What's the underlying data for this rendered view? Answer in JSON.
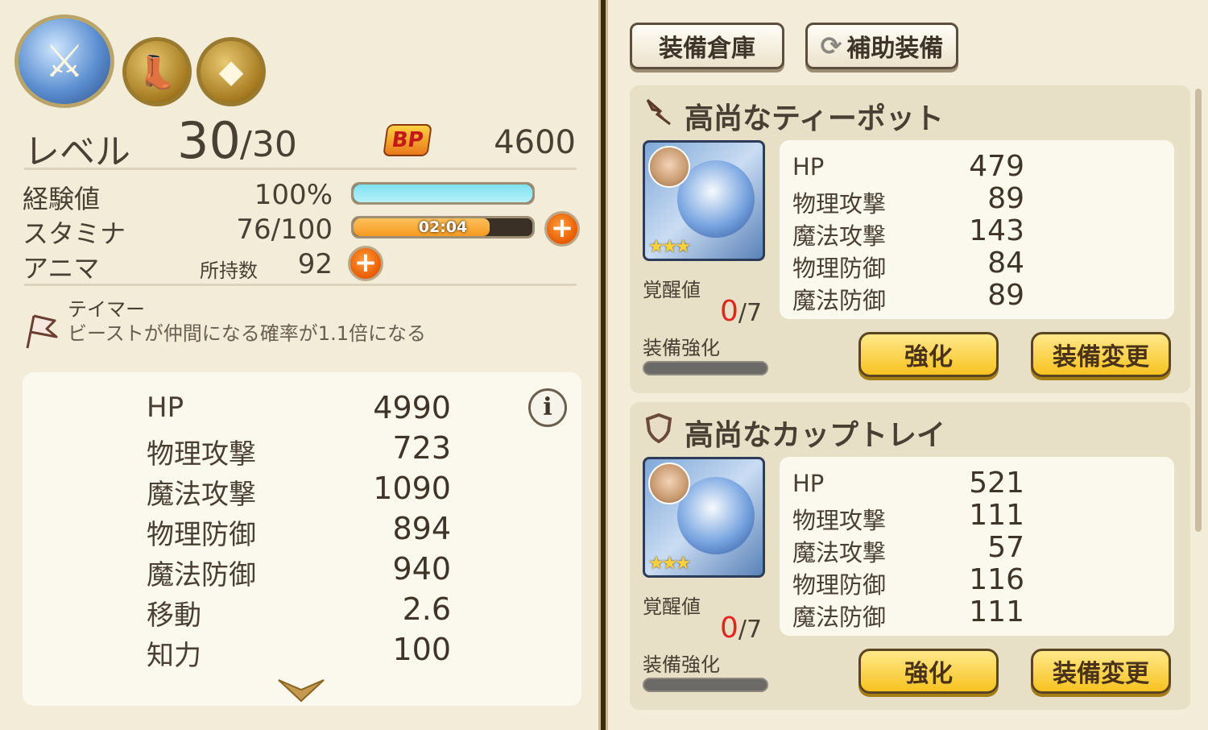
{
  "skills": [
    {
      "icon": "sword-skill-icon"
    },
    {
      "icon": "boot-skill-icon"
    },
    {
      "icon": "block-skill-icon"
    }
  ],
  "level": {
    "label": "レベル",
    "current": "30",
    "max": "/30"
  },
  "bp": {
    "badge": "BP",
    "value": "4600"
  },
  "exp": {
    "label": "経験値",
    "value": "100%",
    "fill": 1.0
  },
  "stamina": {
    "label": "スタミナ",
    "value": "76/100",
    "timer": "02:04",
    "fill": 0.76
  },
  "anima": {
    "label": "アニマ",
    "owned_label": "所持数",
    "value": "92"
  },
  "trait": {
    "title": "テイマー",
    "description": "ビーストが仲間になる確率が1.1倍になる"
  },
  "stats": [
    {
      "name": "HP",
      "value": "4990"
    },
    {
      "name": "物理攻撃",
      "value": "723"
    },
    {
      "name": "魔法攻撃",
      "value": "1090"
    },
    {
      "name": "物理防御",
      "value": "894"
    },
    {
      "name": "魔法防御",
      "value": "940"
    },
    {
      "name": "移動",
      "value": "2.6"
    },
    {
      "name": "知力",
      "value": "100"
    }
  ],
  "info_button": "i",
  "tabs": {
    "storage": "装備倉庫",
    "support": "補助装備"
  },
  "equipment": [
    {
      "type_icon": "weapon-icon",
      "name": "高尚なティーポット",
      "stars": "★★★",
      "awakening_label": "覚醒値",
      "awakening_current": "0",
      "awakening_max": "/7",
      "enhance_label": "装備強化",
      "stats": [
        {
          "name": "HP",
          "value": "479"
        },
        {
          "name": "物理攻撃",
          "value": "89"
        },
        {
          "name": "魔法攻撃",
          "value": "143"
        },
        {
          "name": "物理防御",
          "value": "84"
        },
        {
          "name": "魔法防御",
          "value": "89"
        }
      ],
      "enhance_button": "強化",
      "change_button": "装備変更"
    },
    {
      "type_icon": "shield-icon",
      "name": "高尚なカップトレイ",
      "stars": "★★★",
      "awakening_label": "覚醒値",
      "awakening_current": "0",
      "awakening_max": "/7",
      "enhance_label": "装備強化",
      "stats": [
        {
          "name": "HP",
          "value": "521"
        },
        {
          "name": "物理攻撃",
          "value": "111"
        },
        {
          "name": "魔法攻撃",
          "value": "57"
        },
        {
          "name": "物理防御",
          "value": "116"
        },
        {
          "name": "魔法防御",
          "value": "111"
        }
      ],
      "enhance_button": "強化",
      "change_button": "装備変更"
    }
  ],
  "colors": {
    "exp_bar": "#7fe0ef",
    "stamina_bar": "#f59a20",
    "awakening_current": "#e2261e",
    "panel_bg": "#f2ecd9"
  }
}
